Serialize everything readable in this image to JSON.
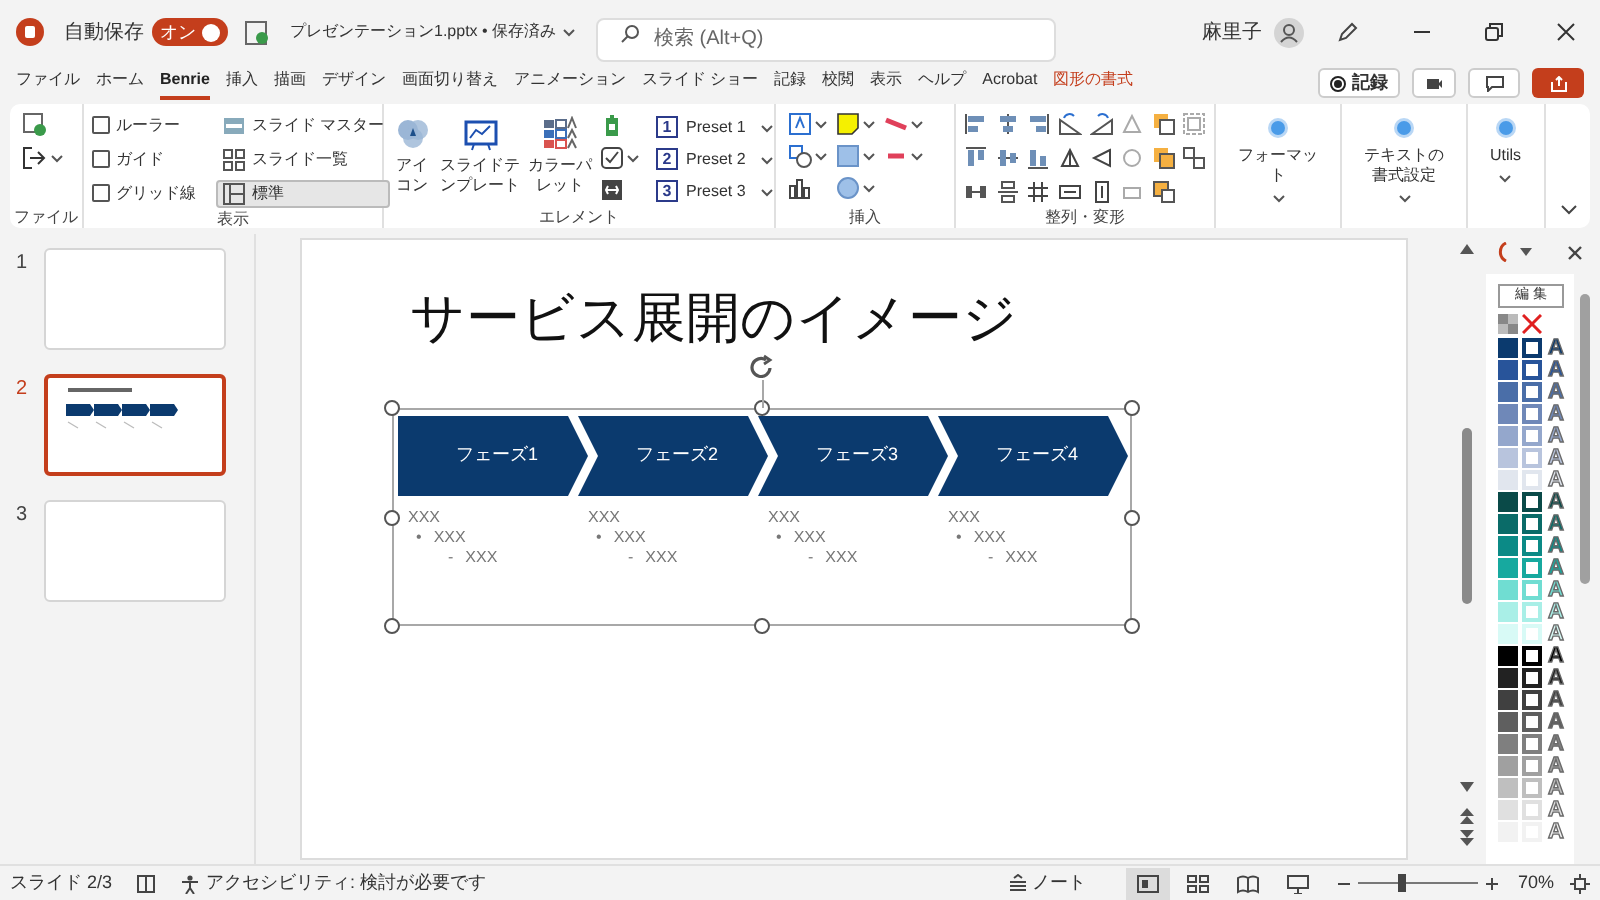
{
  "title_bar": {
    "autosave_label": "自動保存",
    "autosave": {
      "on": true,
      "label": "オン"
    },
    "file_name": "プレゼンテーション1.pptx • 保存済み",
    "search": {
      "placeholder": "検索 (Alt+Q)"
    },
    "user_name": "麻里子"
  },
  "ribbon_tabs": [
    {
      "label": "ファイル",
      "selected": false,
      "kind": "normal"
    },
    {
      "label": "ホーム",
      "selected": false,
      "kind": "normal"
    },
    {
      "label": "Benrie",
      "selected": true,
      "kind": "normal"
    },
    {
      "label": "挿入",
      "selected": false,
      "kind": "normal"
    },
    {
      "label": "描画",
      "selected": false,
      "kind": "normal"
    },
    {
      "label": "デザイン",
      "selected": false,
      "kind": "normal"
    },
    {
      "label": "画面切り替え",
      "selected": false,
      "kind": "normal"
    },
    {
      "label": "アニメーション",
      "selected": false,
      "kind": "normal"
    },
    {
      "label": "スライド ショー",
      "selected": false,
      "kind": "normal"
    },
    {
      "label": "記録",
      "selected": false,
      "kind": "normal"
    },
    {
      "label": "校閲",
      "selected": false,
      "kind": "normal"
    },
    {
      "label": "表示",
      "selected": false,
      "kind": "normal"
    },
    {
      "label": "ヘルプ",
      "selected": false,
      "kind": "normal"
    },
    {
      "label": "Acrobat",
      "selected": false,
      "kind": "normal"
    },
    {
      "label": "図形の書式",
      "selected": false,
      "kind": "contextual"
    }
  ],
  "record_button": "記録",
  "ribbon": {
    "file_group": {
      "label": "ファイル"
    },
    "view_group": {
      "label": "表示",
      "checkboxes": [
        {
          "label": "ルーラー",
          "checked": false
        },
        {
          "label": "ガイド",
          "checked": false
        },
        {
          "label": "グリッド線",
          "checked": false
        }
      ],
      "buttons": [
        {
          "label": "スライド マスター",
          "selected": false
        },
        {
          "label": "スライド一覧",
          "selected": false
        },
        {
          "label": "標準",
          "selected": true
        }
      ]
    },
    "element_group": {
      "label": "エレメント",
      "large_buttons": [
        {
          "label": "アイコン",
          "kind": "icons"
        },
        {
          "label": "スライドテンプレート",
          "kind": "template"
        },
        {
          "label": "カラーパレット",
          "kind": "palette"
        }
      ],
      "presets": [
        {
          "badge": "1",
          "label": "Preset 1"
        },
        {
          "badge": "2",
          "label": "Preset 2"
        },
        {
          "badge": "3",
          "label": "Preset 3"
        }
      ]
    },
    "insert_group": {
      "label": "挿入"
    },
    "arrange_group": {
      "label": "整列・変形"
    },
    "large_buttons": [
      {
        "label": "フォーマット"
      },
      {
        "label": "テキストの書式設定"
      },
      {
        "label": "Utils"
      }
    ]
  },
  "thumbnails": [
    {
      "number": "1",
      "selected": false,
      "kind": "blank"
    },
    {
      "number": "2",
      "selected": true,
      "kind": "content"
    },
    {
      "number": "3",
      "selected": false,
      "kind": "blank"
    }
  ],
  "slide": {
    "title": "サービス展開のイメージ",
    "phases": [
      {
        "label": "フェーズ1",
        "items": [
          {
            "text": "XXX",
            "children": [
              {
                "marker": "•",
                "text": "XXX",
                "children": [
                  {
                    "marker": "-",
                    "text": "XXX"
                  }
                ]
              }
            ]
          }
        ]
      },
      {
        "label": "フェーズ2",
        "items": [
          {
            "text": "XXX",
            "children": [
              {
                "marker": "•",
                "text": "XXX",
                "children": [
                  {
                    "marker": "-",
                    "text": "XXX"
                  }
                ]
              }
            ]
          }
        ]
      },
      {
        "label": "フェーズ3",
        "items": [
          {
            "text": "XXX",
            "children": [
              {
                "marker": "•",
                "text": "XXX",
                "children": [
                  {
                    "marker": "-",
                    "text": "XXX"
                  }
                ]
              }
            ]
          }
        ]
      },
      {
        "label": "フェーズ4",
        "items": [
          {
            "text": "XXX",
            "children": [
              {
                "marker": "•",
                "text": "XXX",
                "children": [
                  {
                    "marker": "-",
                    "text": "XXX"
                  }
                ]
              }
            ]
          }
        ]
      }
    ]
  },
  "palette": {
    "edit_button": "編 集",
    "rows": [
      {
        "color": "#0b3a6e",
        "glyph": "A"
      },
      {
        "color": "#28549a",
        "glyph": "A"
      },
      {
        "color": "#4a6ea8",
        "glyph": "A"
      },
      {
        "color": "#6f88b8",
        "glyph": "A"
      },
      {
        "color": "#94a7cc",
        "glyph": "A"
      },
      {
        "color": "#b8c4dd",
        "glyph": "A"
      },
      {
        "color": "#e1e6ee",
        "glyph": "A"
      },
      {
        "color": "#0a4a48",
        "glyph": "A"
      },
      {
        "color": "#0a6b68",
        "glyph": "A"
      },
      {
        "color": "#0b8a86",
        "glyph": "A"
      },
      {
        "color": "#17a99f",
        "glyph": "A"
      },
      {
        "color": "#70ddd2",
        "glyph": "A"
      },
      {
        "color": "#a9efe7",
        "glyph": "A"
      },
      {
        "color": "#d8faf6",
        "glyph": "A"
      },
      {
        "color": "#000000",
        "glyph": "A"
      },
      {
        "color": "#222222",
        "glyph": "A"
      },
      {
        "color": "#404040",
        "glyph": "A"
      },
      {
        "color": "#5f5f5f",
        "glyph": "A"
      },
      {
        "color": "#7f7f7f",
        "glyph": "A"
      },
      {
        "color": "#a0a0a0",
        "glyph": "A"
      },
      {
        "color": "#bfbfbf",
        "glyph": "A"
      },
      {
        "color": "#e0e0e0",
        "glyph": "A"
      },
      {
        "color": "#f2f2f2",
        "glyph": "A"
      }
    ]
  },
  "status_bar": {
    "slide": "スライド 2/3",
    "accessibility": "アクセシビリティ: 検討が必要です",
    "notes": "ノート",
    "views": [
      {
        "kind": "normal",
        "selected": true
      },
      {
        "kind": "sorter",
        "selected": false
      },
      {
        "kind": "reading",
        "selected": false
      },
      {
        "kind": "presenter",
        "selected": false
      }
    ],
    "zoom": {
      "level": 0.36,
      "reading": "70%"
    }
  }
}
